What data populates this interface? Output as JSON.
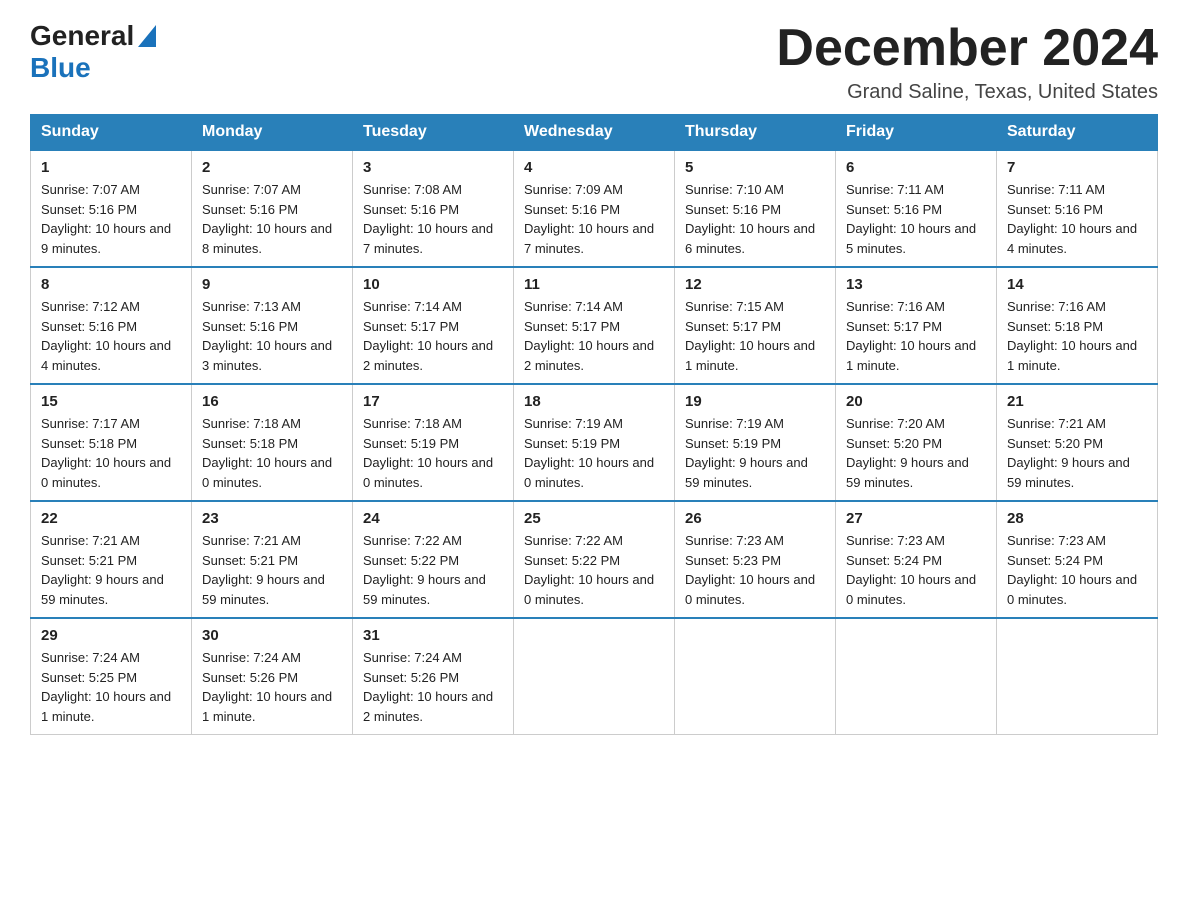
{
  "logo": {
    "general": "General",
    "blue": "Blue"
  },
  "header": {
    "month_year": "December 2024",
    "location": "Grand Saline, Texas, United States"
  },
  "weekdays": [
    "Sunday",
    "Monday",
    "Tuesday",
    "Wednesday",
    "Thursday",
    "Friday",
    "Saturday"
  ],
  "weeks": [
    [
      {
        "day": "1",
        "sunrise": "7:07 AM",
        "sunset": "5:16 PM",
        "daylight": "10 hours and 9 minutes."
      },
      {
        "day": "2",
        "sunrise": "7:07 AM",
        "sunset": "5:16 PM",
        "daylight": "10 hours and 8 minutes."
      },
      {
        "day": "3",
        "sunrise": "7:08 AM",
        "sunset": "5:16 PM",
        "daylight": "10 hours and 7 minutes."
      },
      {
        "day": "4",
        "sunrise": "7:09 AM",
        "sunset": "5:16 PM",
        "daylight": "10 hours and 7 minutes."
      },
      {
        "day": "5",
        "sunrise": "7:10 AM",
        "sunset": "5:16 PM",
        "daylight": "10 hours and 6 minutes."
      },
      {
        "day": "6",
        "sunrise": "7:11 AM",
        "sunset": "5:16 PM",
        "daylight": "10 hours and 5 minutes."
      },
      {
        "day": "7",
        "sunrise": "7:11 AM",
        "sunset": "5:16 PM",
        "daylight": "10 hours and 4 minutes."
      }
    ],
    [
      {
        "day": "8",
        "sunrise": "7:12 AM",
        "sunset": "5:16 PM",
        "daylight": "10 hours and 4 minutes."
      },
      {
        "day": "9",
        "sunrise": "7:13 AM",
        "sunset": "5:16 PM",
        "daylight": "10 hours and 3 minutes."
      },
      {
        "day": "10",
        "sunrise": "7:14 AM",
        "sunset": "5:17 PM",
        "daylight": "10 hours and 2 minutes."
      },
      {
        "day": "11",
        "sunrise": "7:14 AM",
        "sunset": "5:17 PM",
        "daylight": "10 hours and 2 minutes."
      },
      {
        "day": "12",
        "sunrise": "7:15 AM",
        "sunset": "5:17 PM",
        "daylight": "10 hours and 1 minute."
      },
      {
        "day": "13",
        "sunrise": "7:16 AM",
        "sunset": "5:17 PM",
        "daylight": "10 hours and 1 minute."
      },
      {
        "day": "14",
        "sunrise": "7:16 AM",
        "sunset": "5:18 PM",
        "daylight": "10 hours and 1 minute."
      }
    ],
    [
      {
        "day": "15",
        "sunrise": "7:17 AM",
        "sunset": "5:18 PM",
        "daylight": "10 hours and 0 minutes."
      },
      {
        "day": "16",
        "sunrise": "7:18 AM",
        "sunset": "5:18 PM",
        "daylight": "10 hours and 0 minutes."
      },
      {
        "day": "17",
        "sunrise": "7:18 AM",
        "sunset": "5:19 PM",
        "daylight": "10 hours and 0 minutes."
      },
      {
        "day": "18",
        "sunrise": "7:19 AM",
        "sunset": "5:19 PM",
        "daylight": "10 hours and 0 minutes."
      },
      {
        "day": "19",
        "sunrise": "7:19 AM",
        "sunset": "5:19 PM",
        "daylight": "9 hours and 59 minutes."
      },
      {
        "day": "20",
        "sunrise": "7:20 AM",
        "sunset": "5:20 PM",
        "daylight": "9 hours and 59 minutes."
      },
      {
        "day": "21",
        "sunrise": "7:21 AM",
        "sunset": "5:20 PM",
        "daylight": "9 hours and 59 minutes."
      }
    ],
    [
      {
        "day": "22",
        "sunrise": "7:21 AM",
        "sunset": "5:21 PM",
        "daylight": "9 hours and 59 minutes."
      },
      {
        "day": "23",
        "sunrise": "7:21 AM",
        "sunset": "5:21 PM",
        "daylight": "9 hours and 59 minutes."
      },
      {
        "day": "24",
        "sunrise": "7:22 AM",
        "sunset": "5:22 PM",
        "daylight": "9 hours and 59 minutes."
      },
      {
        "day": "25",
        "sunrise": "7:22 AM",
        "sunset": "5:22 PM",
        "daylight": "10 hours and 0 minutes."
      },
      {
        "day": "26",
        "sunrise": "7:23 AM",
        "sunset": "5:23 PM",
        "daylight": "10 hours and 0 minutes."
      },
      {
        "day": "27",
        "sunrise": "7:23 AM",
        "sunset": "5:24 PM",
        "daylight": "10 hours and 0 minutes."
      },
      {
        "day": "28",
        "sunrise": "7:23 AM",
        "sunset": "5:24 PM",
        "daylight": "10 hours and 0 minutes."
      }
    ],
    [
      {
        "day": "29",
        "sunrise": "7:24 AM",
        "sunset": "5:25 PM",
        "daylight": "10 hours and 1 minute."
      },
      {
        "day": "30",
        "sunrise": "7:24 AM",
        "sunset": "5:26 PM",
        "daylight": "10 hours and 1 minute."
      },
      {
        "day": "31",
        "sunrise": "7:24 AM",
        "sunset": "5:26 PM",
        "daylight": "10 hours and 2 minutes."
      },
      null,
      null,
      null,
      null
    ]
  ],
  "labels": {
    "sunrise": "Sunrise:",
    "sunset": "Sunset:",
    "daylight": "Daylight:"
  }
}
